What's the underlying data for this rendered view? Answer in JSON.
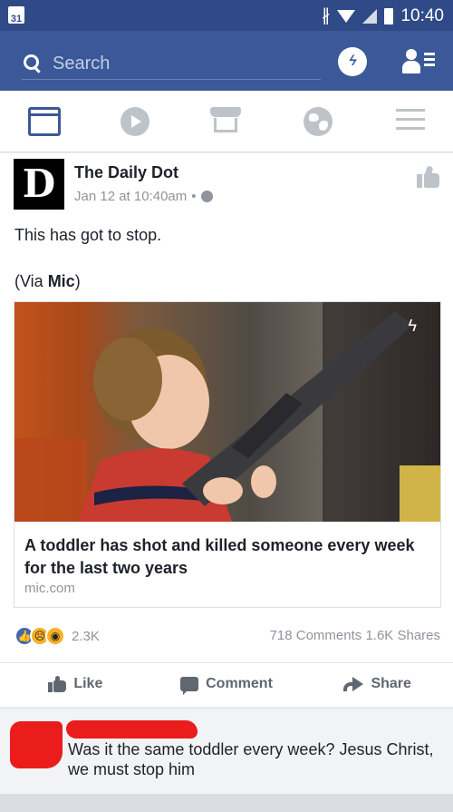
{
  "statusbar": {
    "calendar_day": "31",
    "time": "10:40"
  },
  "header": {
    "search_placeholder": "Search"
  },
  "post": {
    "page_logo": "D",
    "page_name": "The Daily Dot",
    "timestamp": "Jan 12 at 10:40am",
    "separator": "•",
    "text": "This has got to stop.",
    "via_prefix": "(Via ",
    "via_source": "Mic",
    "via_suffix": ")",
    "link": {
      "title": "A toddler has shot and killed someone every week for the last two years",
      "domain": "mic.com"
    },
    "reaction_count": "2.3K",
    "counts": "718 Comments 1.6K Shares",
    "actions": {
      "like": "Like",
      "comment": "Comment",
      "share": "Share"
    }
  },
  "comment": {
    "text": "Was it the same toddler every week? Jesus Christ, we must stop him"
  },
  "colors": {
    "brand": "#3b5998",
    "statusbar": "#2f4a86",
    "redaction": "#ea1c1c"
  }
}
